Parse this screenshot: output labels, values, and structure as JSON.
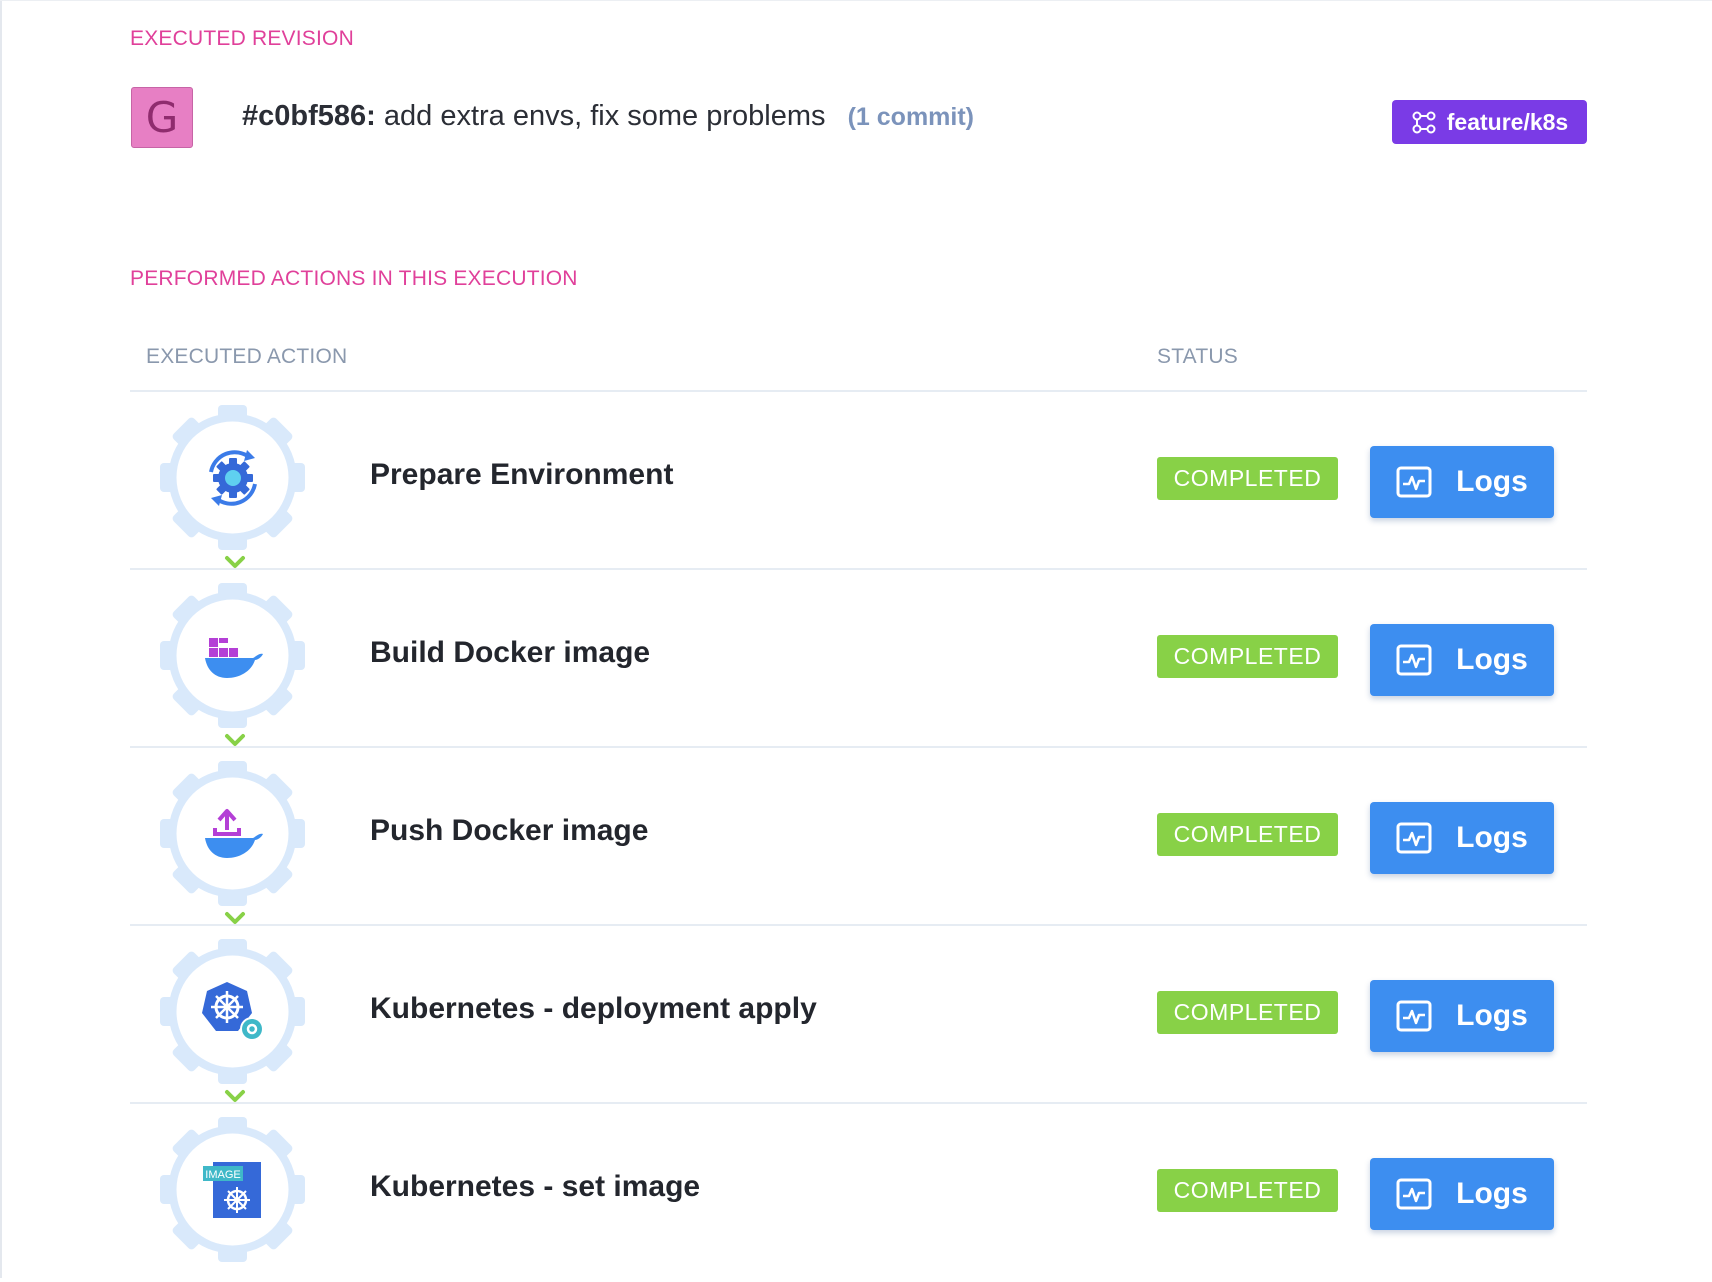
{
  "revision": {
    "section_title": "EXECUTED REVISION",
    "avatar_letter": "G",
    "commit_hash": "#c0bf586:",
    "commit_message": "add extra envs, fix some problems",
    "commit_count": "(1 commit)",
    "branch": "feature/k8s"
  },
  "actions": {
    "section_title": "PERFORMED ACTIONS IN THIS EXECUTION",
    "col_action": "EXECUTED ACTION",
    "col_status": "STATUS",
    "steps": [
      {
        "label": "Prepare Environment",
        "status": "COMPLETED",
        "logs": "Logs",
        "icon": "gear-refresh-icon"
      },
      {
        "label": "Build Docker image",
        "status": "COMPLETED",
        "logs": "Logs",
        "icon": "docker-build-icon"
      },
      {
        "label": "Push Docker image",
        "status": "COMPLETED",
        "logs": "Logs",
        "icon": "docker-push-icon"
      },
      {
        "label": "Kubernetes - deployment apply",
        "status": "COMPLETED",
        "logs": "Logs",
        "icon": "kubernetes-apply-icon"
      },
      {
        "label": "Kubernetes - set image",
        "status": "COMPLETED",
        "logs": "Logs",
        "icon": "kubernetes-image-icon",
        "icon_text": "IMAGE"
      }
    ]
  },
  "colors": {
    "section_title": "#e0409a",
    "completed": "#88d147",
    "logs_button": "#3d8ef0",
    "branch_tag": "#7a3be6",
    "avatar": "#e77fc4",
    "connector": "#88d147"
  }
}
